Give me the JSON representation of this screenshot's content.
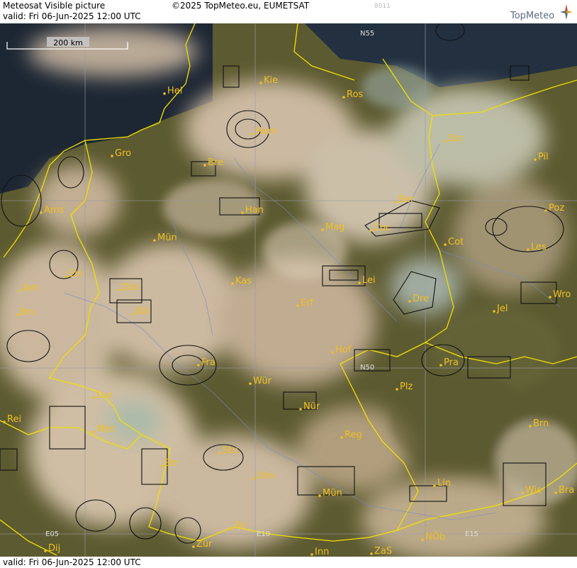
{
  "header": {
    "title": "Meteosat Visible picture",
    "valid": "valid:  Fri   06-Jun-2025  12:00 UTC",
    "copyright": "©2025 TopMeteo.eu, EUMETSAT",
    "code": "8011",
    "brand": "TopMeteo"
  },
  "footer": {
    "valid": "valid:  Fri   06-Jun-2025  12:00 UTC"
  },
  "scale": {
    "label": "200 km"
  },
  "colors": {
    "border": "#f0e000",
    "city": "#f0c020",
    "cloud": "#e8d8c4",
    "land": "#5a5628",
    "sea": "#1a2530"
  },
  "grid_labels": [
    {
      "id": "n55",
      "text": "N55"
    },
    {
      "id": "n50",
      "text": "N50"
    },
    {
      "id": "e05",
      "text": "E05"
    },
    {
      "id": "e10",
      "text": "E10"
    },
    {
      "id": "e15",
      "text": "E15"
    }
  ],
  "cities": [
    {
      "id": "hel",
      "text": "Hel"
    },
    {
      "id": "kie",
      "text": "Kie"
    },
    {
      "id": "ros",
      "text": "Ros"
    },
    {
      "id": "ham",
      "text": "Ham"
    },
    {
      "id": "szc",
      "text": "Szc"
    },
    {
      "id": "gro",
      "text": "Gro"
    },
    {
      "id": "bre",
      "text": "Bre"
    },
    {
      "id": "pil",
      "text": "Pil"
    },
    {
      "id": "ams",
      "text": "Ams"
    },
    {
      "id": "han",
      "text": "Han"
    },
    {
      "id": "ber",
      "text": "Ber"
    },
    {
      "id": "poz",
      "text": "Poz"
    },
    {
      "id": "mun",
      "text": "Mün"
    },
    {
      "id": "mag",
      "text": "Mag"
    },
    {
      "id": "coc",
      "text": "Coc"
    },
    {
      "id": "cot",
      "text": "Cot"
    },
    {
      "id": "les",
      "text": "Les"
    },
    {
      "id": "ein",
      "text": "Ein"
    },
    {
      "id": "kas",
      "text": "Kas"
    },
    {
      "id": "lei",
      "text": "Lei"
    },
    {
      "id": "ant",
      "text": "Ant"
    },
    {
      "id": "dus",
      "text": "Düs"
    },
    {
      "id": "wro",
      "text": "Wro"
    },
    {
      "id": "bru",
      "text": "Bru"
    },
    {
      "id": "kol",
      "text": "Köl"
    },
    {
      "id": "erf",
      "text": "Erf"
    },
    {
      "id": "dre",
      "text": "Dre"
    },
    {
      "id": "jel",
      "text": "Jel"
    },
    {
      "id": "hof",
      "text": "Hof"
    },
    {
      "id": "fra",
      "text": "Fra"
    },
    {
      "id": "pra",
      "text": "Pra"
    },
    {
      "id": "lux",
      "text": "Lux"
    },
    {
      "id": "wur",
      "text": "Wür"
    },
    {
      "id": "plz",
      "text": "Plz"
    },
    {
      "id": "rei",
      "text": "Rei"
    },
    {
      "id": "nur",
      "text": "Nür"
    },
    {
      "id": "met",
      "text": "Met"
    },
    {
      "id": "brn",
      "text": "Brn"
    },
    {
      "id": "reg",
      "text": "Reg"
    },
    {
      "id": "str",
      "text": "Str"
    },
    {
      "id": "stu",
      "text": "Stu"
    },
    {
      "id": "ulm",
      "text": "Ulm"
    },
    {
      "id": "lin",
      "text": "Lin"
    },
    {
      "id": "munich",
      "text": "Mün"
    },
    {
      "id": "wie",
      "text": "Wie"
    },
    {
      "id": "bra",
      "text": "Bra"
    },
    {
      "id": "fri",
      "text": "Fri"
    },
    {
      "id": "dij",
      "text": "Dij"
    },
    {
      "id": "zur",
      "text": "Zür"
    },
    {
      "id": "inn",
      "text": "Inn"
    },
    {
      "id": "zas",
      "text": "ZaS"
    },
    {
      "id": "nob",
      "text": "NÖb"
    }
  ]
}
